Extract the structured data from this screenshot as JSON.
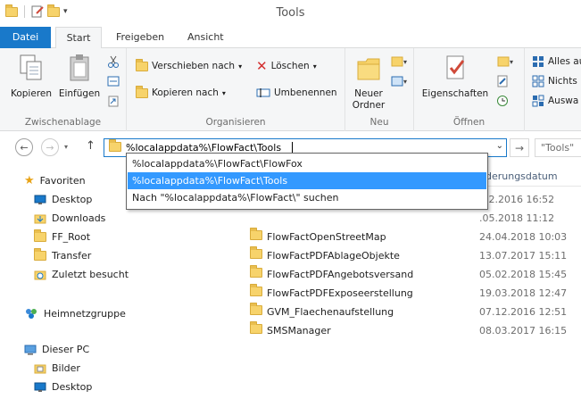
{
  "window": {
    "title": "Tools"
  },
  "ribbon_tabs": {
    "file": "Datei",
    "start": "Start",
    "share": "Freigeben",
    "view": "Ansicht"
  },
  "ribbon": {
    "clipboard": {
      "label": "Zwischenablage",
      "copy": "Kopieren",
      "paste": "Einfügen"
    },
    "organize": {
      "label": "Organisieren",
      "move_to": "Verschieben nach",
      "copy_to": "Kopieren nach",
      "delete": "Löschen",
      "rename": "Umbenennen"
    },
    "new": {
      "label": "Neu",
      "new_folder_line1": "Neuer",
      "new_folder_line2": "Ordner"
    },
    "open": {
      "label": "Öffnen",
      "properties": "Eigenschaften"
    },
    "select": {
      "select_all": "Alles au",
      "select_none": "Nichts",
      "invert": "Auswa"
    }
  },
  "address": {
    "value": "%localappdata%\\FlowFact\\Tools",
    "search_placeholder": "\"Tools\""
  },
  "autocomplete": [
    "%localappdata%\\FlowFact\\FlowFox",
    "%localappdata%\\FlowFact\\Tools",
    "Nach \"%localappdata%\\FlowFact\\\" suchen"
  ],
  "nav_pane": {
    "favorites": "Favoriten",
    "items": [
      "Desktop",
      "Downloads",
      "FF_Root",
      "Transfer",
      "Zuletzt besucht"
    ],
    "homegroup": "Heimnetzgruppe",
    "this_pc": "Dieser PC",
    "pc_items": [
      "Bilder",
      "Desktop"
    ]
  },
  "file_list": {
    "date_header": "nderungsdatum",
    "rows": [
      {
        "name": "",
        "date": ".12.2016 16:52"
      },
      {
        "name": "",
        "date": ".05.2018 11:12"
      },
      {
        "name": "FlowFactOpenStreetMap",
        "date": "24.04.2018 10:03"
      },
      {
        "name": "FlowFactPDFAblageObjekte",
        "date": "13.07.2017 15:11"
      },
      {
        "name": "FlowFactPDFAngebotsversand",
        "date": "05.02.2018 15:45"
      },
      {
        "name": "FlowFactPDFExposeerstellung",
        "date": "19.03.2018 12:47"
      },
      {
        "name": "GVM_Flaechenaufstellung",
        "date": "07.12.2016 12:51"
      },
      {
        "name": "SMSManager",
        "date": "08.03.2017 16:15"
      }
    ]
  },
  "colors": {
    "accent": "#1979ca",
    "selection": "#3399ff"
  }
}
